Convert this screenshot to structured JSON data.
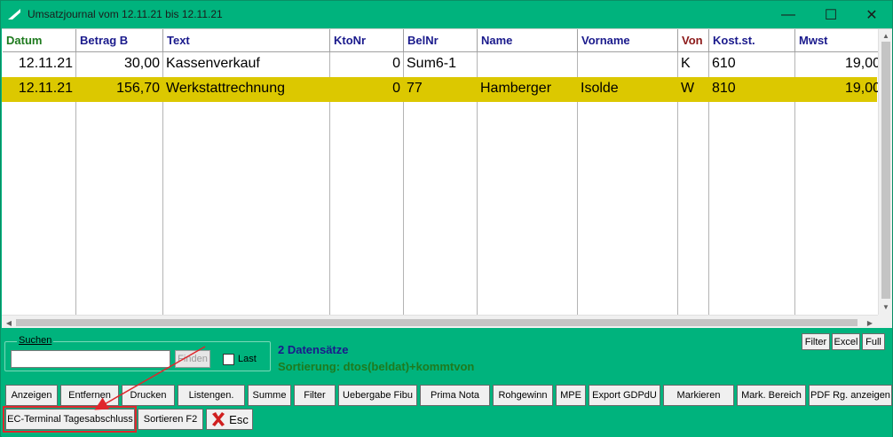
{
  "window": {
    "title": "Umsatzjournal vom 12.11.21 bis 12.11.21",
    "controls": {
      "minimize": "—",
      "maximize": "☐",
      "close": "✕"
    }
  },
  "grid": {
    "columns": [
      {
        "label": "Datum",
        "color": "#1e7a1e"
      },
      {
        "label": "Betrag B",
        "color": "#1a1a8c"
      },
      {
        "label": "Text",
        "color": "#1a1a8c"
      },
      {
        "label": "KtoNr",
        "color": "#1a1a8c"
      },
      {
        "label": "BelNr",
        "color": "#1a1a8c"
      },
      {
        "label": "Name",
        "color": "#1a1a8c"
      },
      {
        "label": "Vorname",
        "color": "#1a1a8c"
      },
      {
        "label": "Von",
        "color": "#8c1a1a"
      },
      {
        "label": "Kost.st.",
        "color": "#1a1a8c"
      },
      {
        "label": "Mwst",
        "color": "#1a1a8c"
      }
    ],
    "rows": [
      {
        "selected": false,
        "cells": [
          "12.11.21",
          "30,00",
          "Kassenverkauf",
          "0",
          "Sum6-1",
          "",
          "",
          "K",
          "610",
          "19,00"
        ]
      },
      {
        "selected": true,
        "cells": [
          "12.11.21",
          "156,70",
          "Werkstattrechnung",
          "0",
          "77",
          "Hamberger",
          "Isolde",
          "W",
          "810",
          "19,00"
        ]
      }
    ]
  },
  "search": {
    "legend": "Suchen",
    "value": "",
    "find_label": "Finden",
    "last_label": "Last",
    "last_checked": false
  },
  "status": {
    "count": "2 Datensätze",
    "sort": "Sortierung: dtos(beldat)+kommtvon"
  },
  "top_right_buttons": [
    "Filter",
    "Excel",
    "Full"
  ],
  "buttons_row1": [
    "Anzeigen",
    "Entfernen",
    "Drucken",
    "Listengen.",
    "Summe",
    "Filter",
    "Uebergabe Fibu",
    "Prima Nota",
    "Rohgewinn",
    "MPE",
    "Export GDPdU",
    "Markieren",
    "Mark. Bereich",
    "PDF Rg. anzeigen"
  ],
  "buttons_row2": {
    "ec_terminal": "EC-Terminal Tagesabschluss",
    "sort_f2": "Sortieren F2",
    "esc": "Esc"
  },
  "colors": {
    "title_bar": "#00b37d",
    "selected_row": "#dcc800",
    "annotation": "#e0262c"
  }
}
